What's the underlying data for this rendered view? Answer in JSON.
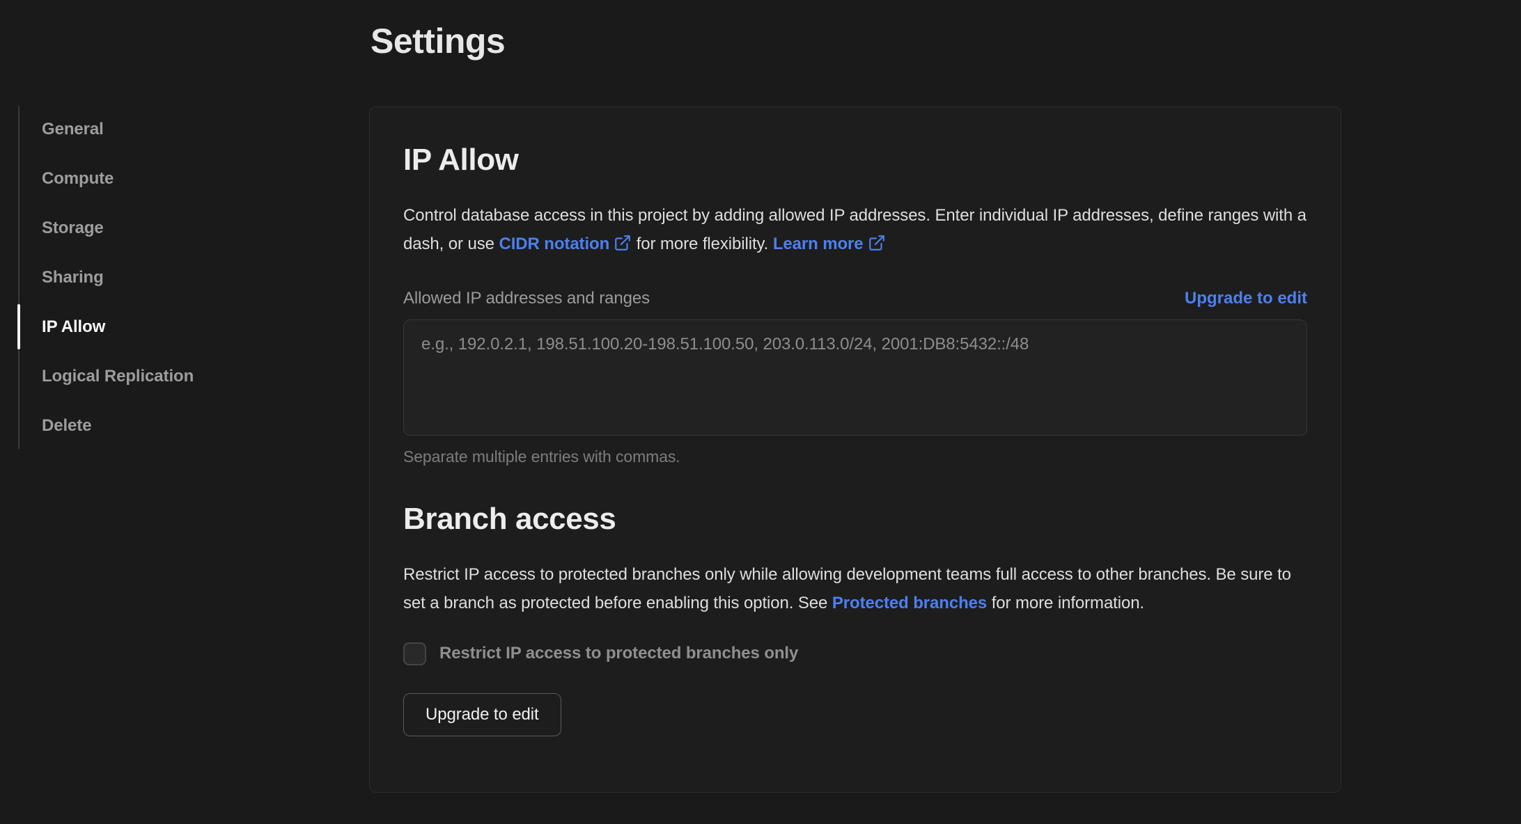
{
  "page": {
    "title": "Settings"
  },
  "colors": {
    "page_bg": "#1a1a1a",
    "card_bg": "#1d1d1d",
    "card_border": "#2e2e2e",
    "accent_blue": "#4c80f0",
    "active_text": "#fafafa",
    "muted_text": "#9d9d9d"
  },
  "sidebar": {
    "items": [
      {
        "label": "General",
        "active": false
      },
      {
        "label": "Compute",
        "active": false
      },
      {
        "label": "Storage",
        "active": false
      },
      {
        "label": "Sharing",
        "active": false
      },
      {
        "label": "IP Allow",
        "active": true
      },
      {
        "label": "Logical Replication",
        "active": false
      },
      {
        "label": "Delete",
        "active": false
      }
    ]
  },
  "ip_allow": {
    "heading": "IP Allow",
    "desc_part1": "Control database access in this project by adding allowed IP addresses. Enter individual IP addresses, define ranges with a dash, or use",
    "cidr_link_label": "CIDR notation",
    "desc_part2": "for more flexibility.",
    "learn_more_label": "Learn more",
    "field_label": "Allowed IP addresses and ranges",
    "upgrade_link_label": "Upgrade to edit",
    "textarea_value": "",
    "textarea_placeholder": "e.g., 192.0.2.1, 198.51.100.20-198.51.100.50, 203.0.113.0/24, 2001:DB8:5432::/48",
    "helper": "Separate multiple entries with commas."
  },
  "branch_access": {
    "heading": "Branch access",
    "desc_part1": "Restrict IP access to protected branches only while allowing development teams full access to other branches. Be sure to set a branch as protected before enabling this option. See",
    "protected_link_label": "Protected branches",
    "desc_part2": "for more information.",
    "checkbox_label": "Restrict IP access to protected branches only",
    "checkbox_checked": false,
    "upgrade_button_label": "Upgrade to edit"
  }
}
